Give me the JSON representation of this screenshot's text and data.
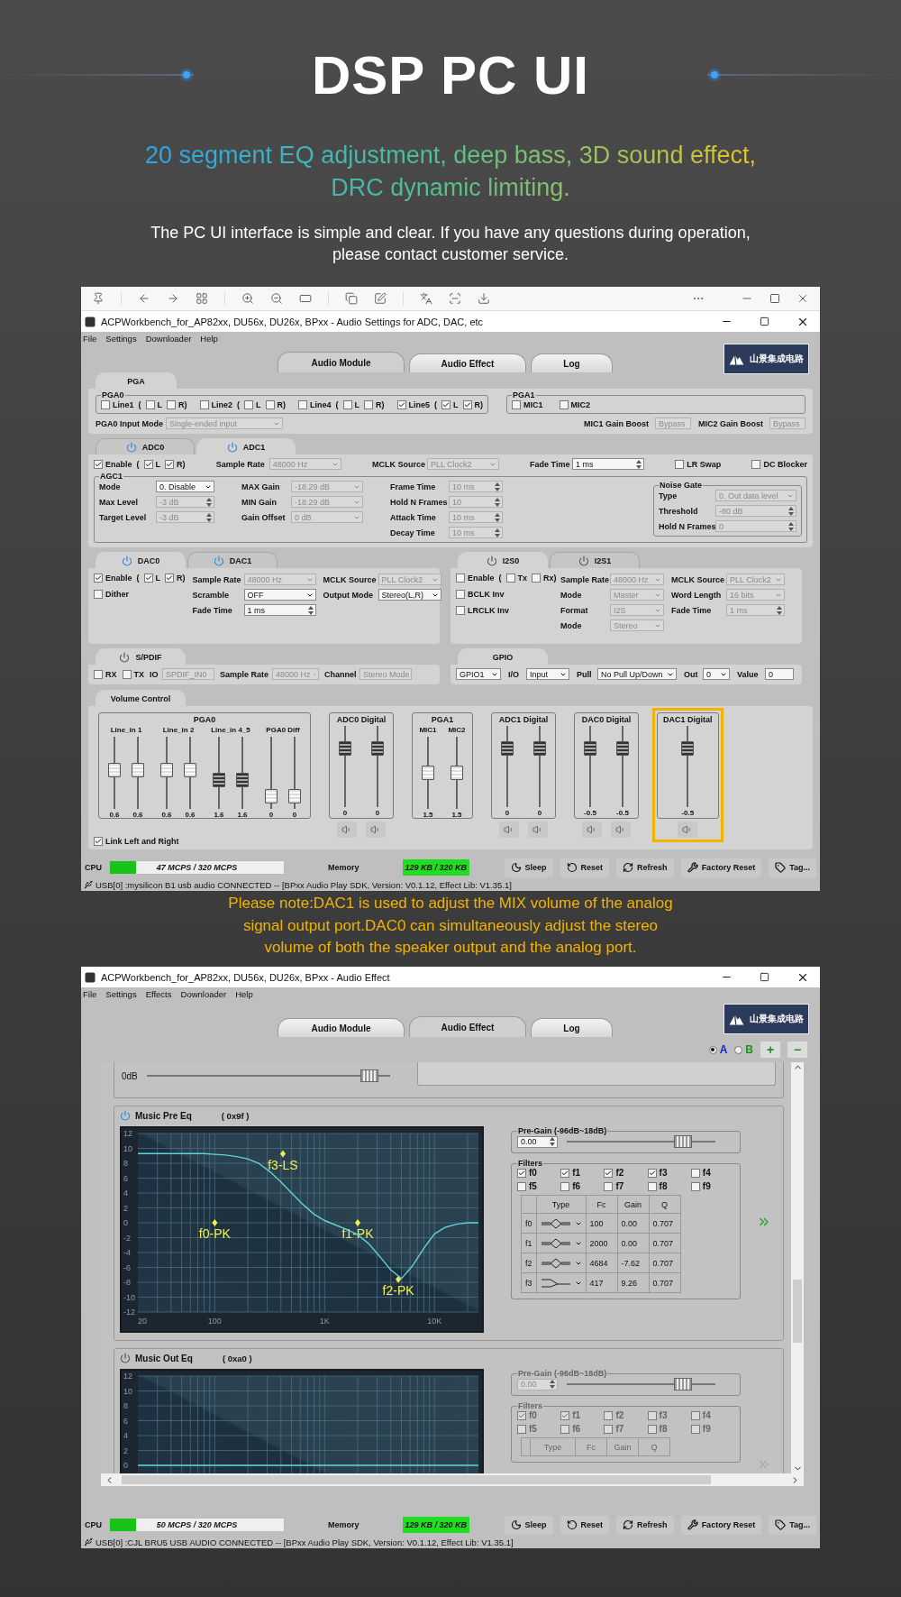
{
  "header": {
    "title": "DSP PC UI",
    "subtitle": [
      "20 segment EQ adjustment, deep bass, 3D sound effect,",
      "DRC dynamic limiting."
    ],
    "description": [
      "The PC UI interface is simple and clear. If you have any questions during operation,",
      "please contact customer service."
    ]
  },
  "settings_window": {
    "title": "ACPWorkbench_for_AP82xx, DU56x, DU26x, BPxx - Audio Settings for ADC, DAC, etc",
    "menu": [
      "File",
      "Settings",
      "Downloader",
      "Help"
    ],
    "tabs": [
      {
        "label": "Audio Module",
        "selected": true
      },
      {
        "label": "Audio Effect",
        "selected": false
      },
      {
        "label": "Log",
        "selected": false
      }
    ],
    "logo": "山景集成电路",
    "pga": {
      "tab": "PGA",
      "pga0": {
        "title": "PGA0",
        "inputs": [
          {
            "label": "Line1",
            "checked": false,
            "open": "(",
            "left": {
              "label": "L",
              "checked": false
            },
            "right": {
              "label": "R)",
              "checked": false
            }
          },
          {
            "label": "Line2",
            "checked": false,
            "open": "(",
            "left": {
              "label": "L",
              "checked": false
            },
            "right": {
              "label": "R)",
              "checked": false
            }
          },
          {
            "label": "Line4",
            "checked": false,
            "open": "(",
            "left": {
              "label": "L",
              "checked": false
            },
            "right": {
              "label": "R)",
              "checked": false
            }
          },
          {
            "label": "Line5",
            "checked": true,
            "open": "(",
            "left": {
              "label": "L",
              "checked": true
            },
            "right": {
              "label": "R)",
              "checked": true
            }
          }
        ],
        "input_mode": {
          "label": "PGA0 Input Mode",
          "value": "Single-ended input",
          "kind": "combo",
          "disabled": true
        }
      },
      "pga1": {
        "title": "PGA1",
        "mics": [
          {
            "label": "MIC1",
            "checked": false
          },
          {
            "label": "MIC2",
            "checked": false
          }
        ],
        "boosts": [
          {
            "label": "MIC1 Gain Boost",
            "value": "Bypass",
            "kind": "combo",
            "disabled": true
          },
          {
            "label": "MIC2 Gain Boost",
            "value": "Bypass",
            "kind": "combo",
            "disabled": true
          }
        ]
      }
    },
    "adc": {
      "tabs": [
        {
          "label": "ADC0",
          "selected": false,
          "powered": true
        },
        {
          "label": "ADC1",
          "selected": true,
          "powered": true
        }
      ],
      "enable": {
        "label": "Enable",
        "checked": true,
        "open": "(",
        "left": {
          "label": "L",
          "checked": true
        },
        "right": {
          "label": "R)",
          "checked": true
        }
      },
      "fields": [
        {
          "label": "Sample Rate",
          "value": "48000 Hz",
          "kind": "combo",
          "disabled": true
        },
        {
          "label": "MCLK Source",
          "value": "PLL Clock2",
          "kind": "combo",
          "disabled": true
        },
        {
          "label": "Fade Time",
          "value": "1 ms",
          "kind": "spin",
          "disabled": false
        }
      ],
      "options": [
        {
          "label": "LR Swap",
          "checked": false
        },
        {
          "label": "DC Blocker",
          "checked": false
        }
      ],
      "agc": {
        "title": "AGC1",
        "columns": [
          [
            {
              "label": "Mode",
              "value": "0. Disable",
              "kind": "combo",
              "disabled": false
            },
            {
              "label": "Max Level",
              "value": "-3 dB",
              "kind": "spin",
              "disabled": true
            },
            {
              "label": "Target Level",
              "value": "-3 dB",
              "kind": "spin",
              "disabled": true
            }
          ],
          [
            {
              "label": "MAX Gain",
              "value": "-18.29 dB",
              "kind": "combo",
              "disabled": true
            },
            {
              "label": "MIN Gain",
              "value": "-18.29 dB",
              "kind": "combo",
              "disabled": true
            },
            {
              "label": "Gain Offset",
              "value": "0 dB",
              "kind": "combo",
              "disabled": true
            }
          ],
          [
            {
              "label": "Frame Time",
              "value": "10 ms",
              "kind": "spin",
              "disabled": true
            },
            {
              "label": "Hold N Frames",
              "value": "10",
              "kind": "spin",
              "disabled": true
            },
            {
              "label": "Attack Time",
              "value": "10 ms",
              "kind": "spin",
              "disabled": true
            },
            {
              "label": "Decay Time",
              "value": "10 ms",
              "kind": "spin",
              "disabled": true
            }
          ]
        ]
      },
      "noise_gate": {
        "title": "Noise Gate",
        "fields": [
          {
            "label": "Type",
            "value": "0. Out data level",
            "kind": "combo",
            "disabled": true
          },
          {
            "label": "Threshold",
            "value": "-80 dB",
            "kind": "spin",
            "disabled": true
          },
          {
            "label": "Hold N Frames",
            "value": "0",
            "kind": "spin",
            "disabled": true
          }
        ]
      }
    },
    "dac": {
      "tabs": [
        {
          "label": "DAC0",
          "selected": true,
          "powered": true
        },
        {
          "label": "DAC1",
          "selected": false,
          "powered": true
        }
      ],
      "enable": {
        "label": "Enable",
        "checked": true,
        "open": "(",
        "left": {
          "label": "L",
          "checked": true
        },
        "right": {
          "label": "R)",
          "checked": true
        }
      },
      "options": [
        {
          "label": "Dither",
          "checked": false
        }
      ],
      "columns": [
        [
          {
            "label": "Sample Rate",
            "value": "48000 Hz",
            "kind": "combo",
            "disabled": true
          },
          {
            "label": "Scramble",
            "value": "OFF",
            "kind": "combo",
            "disabled": false
          },
          {
            "label": "Fade Time",
            "value": "1 ms",
            "kind": "spin",
            "disabled": false
          }
        ],
        [
          {
            "label": "MCLK Source",
            "value": "PLL Clock2",
            "kind": "combo",
            "disabled": true
          },
          {
            "label": "Output Mode",
            "value": "Stereo(L,R)",
            "kind": "combo",
            "disabled": false
          }
        ]
      ]
    },
    "i2s": {
      "tabs": [
        {
          "label": "I2S0",
          "selected": true,
          "powered": false
        },
        {
          "label": "I2S1",
          "selected": false,
          "powered": false
        }
      ],
      "enable": {
        "label": "Enable",
        "checked": false,
        "open": "(",
        "left": {
          "label": "Tx",
          "checked": false
        },
        "right": {
          "label": "Rx)",
          "checked": false
        }
      },
      "options": [
        {
          "label": "BCLK Inv",
          "checked": false
        },
        {
          "label": "LRCLK Inv",
          "checked": false
        }
      ],
      "columns": [
        [
          {
            "label": "Sample Rate",
            "value": "48000 Hz",
            "kind": "combo",
            "disabled": true
          },
          {
            "label": "Mode",
            "value": "Master",
            "kind": "combo",
            "disabled": true
          },
          {
            "label": "Format",
            "value": "I2S",
            "kind": "combo",
            "disabled": true
          },
          {
            "label": "Mode",
            "value": "Stereo",
            "kind": "combo",
            "disabled": true
          }
        ],
        [
          {
            "label": "MCLK Source",
            "value": "PLL Clock2",
            "kind": "combo",
            "disabled": true
          },
          {
            "label": "Word Length",
            "value": "16 bits",
            "kind": "combo",
            "disabled": true
          },
          {
            "label": "Fade Time",
            "value": "1 ms",
            "kind": "spin",
            "disabled": true
          }
        ]
      ]
    },
    "spdif": {
      "tab": {
        "label": "S/PDIF",
        "powered": false
      },
      "options": [
        {
          "label": "RX",
          "checked": false
        },
        {
          "label": "TX",
          "checked": false
        }
      ],
      "fields": [
        {
          "label": "IO",
          "value": "SPDIF_IN0",
          "kind": "combo",
          "disabled": true
        },
        {
          "label": "Sample Rate",
          "value": "48000 Hz",
          "kind": "combo",
          "disabled": true
        },
        {
          "label": "Channel",
          "value": "Stereo Mode",
          "kind": "combo",
          "disabled": true
        }
      ]
    },
    "gpio": {
      "tab": "GPIO",
      "fields": [
        {
          "value": "GPIO1",
          "kind": "combo",
          "disabled": false
        },
        {
          "label": "I/O",
          "value": "Input",
          "kind": "combo",
          "disabled": false
        },
        {
          "label": "Pull",
          "value": "No Pull Up/Down",
          "kind": "combo",
          "disabled": false
        },
        {
          "label": "Out",
          "value": "0",
          "kind": "combo",
          "disabled": false
        },
        {
          "label": "Value",
          "value": "0",
          "kind": "text",
          "disabled": false
        }
      ]
    },
    "volume": {
      "tab": "Volume Control",
      "groups": [
        {
          "title": "PGA0",
          "mute_buttons": false,
          "highlighted": false,
          "columns": [
            {
              "label": "Line_in 1",
              "sliders": [
                {
                  "level": 0.55,
                  "reading": "0.6",
                  "enabled": false
                },
                {
                  "level": 0.55,
                  "reading": "0.6",
                  "enabled": false
                }
              ]
            },
            {
              "label": "Line_in 2",
              "sliders": [
                {
                  "level": 0.55,
                  "reading": "0.6",
                  "enabled": false
                },
                {
                  "level": 0.55,
                  "reading": "0.6",
                  "enabled": false
                }
              ]
            },
            {
              "label": "Line_in 4_5",
              "sliders": [
                {
                  "level": 0.38,
                  "reading": "1.6",
                  "enabled": true
                },
                {
                  "level": 0.38,
                  "reading": "1.6",
                  "enabled": true
                }
              ]
            },
            {
              "label": "PGA0 Diff",
              "sliders": [
                {
                  "level": 0.1,
                  "reading": "0",
                  "enabled": false
                },
                {
                  "level": 0.1,
                  "reading": "0",
                  "enabled": false
                }
              ]
            }
          ]
        },
        {
          "title": "ADC0 Digital",
          "mute_buttons": true,
          "highlighted": false,
          "columns": [
            {
              "sliders": [
                {
                  "level": 0.77,
                  "reading": "0",
                  "enabled": true
                },
                {
                  "level": 0.77,
                  "reading": "0",
                  "enabled": true
                }
              ]
            }
          ]
        },
        {
          "title": "PGA1",
          "mute_buttons": false,
          "highlighted": false,
          "columns": [
            {
              "label": "MIC1",
              "sliders": [
                {
                  "level": 0.5,
                  "reading": "1.5",
                  "enabled": false
                }
              ]
            },
            {
              "label": "MIC2",
              "sliders": [
                {
                  "level": 0.5,
                  "reading": "1.5",
                  "enabled": false
                }
              ]
            }
          ]
        },
        {
          "title": "ADC1 Digital",
          "mute_buttons": true,
          "highlighted": false,
          "columns": [
            {
              "sliders": [
                {
                  "level": 0.77,
                  "reading": "0",
                  "enabled": true
                },
                {
                  "level": 0.77,
                  "reading": "0",
                  "enabled": true
                }
              ]
            }
          ]
        },
        {
          "title": "DAC0 Digital",
          "mute_buttons": true,
          "highlighted": false,
          "columns": [
            {
              "sliders": [
                {
                  "level": 0.77,
                  "reading": "-0.5",
                  "enabled": true
                },
                {
                  "level": 0.77,
                  "reading": "-0.5",
                  "enabled": true
                }
              ]
            }
          ]
        },
        {
          "title": "DAC1 Digital",
          "mute_buttons": true,
          "highlighted": true,
          "columns": [
            {
              "sliders": [
                {
                  "level": 0.77,
                  "reading": "-0.5",
                  "enabled": true
                }
              ]
            }
          ]
        }
      ],
      "link": {
        "label": "Link Left and Right",
        "checked": true
      }
    },
    "status": {
      "cpu": {
        "label": "CPU",
        "reading": "47 MCPS / 320 MCPS",
        "level": 0.15
      },
      "memory": {
        "label": "Memory",
        "reading": "129 KB / 320 KB"
      },
      "buttons": [
        {
          "label": "Sleep",
          "kind": "sleep"
        },
        {
          "label": "Reset",
          "kind": "reset"
        },
        {
          "label": "Refresh",
          "kind": "refresh"
        },
        {
          "label": "Factory Reset",
          "kind": "factory"
        },
        {
          "label": "Tag...",
          "kind": "tag"
        }
      ]
    },
    "footer": "USB[0] :mysilicon B1 usb audio CONNECTED -- [BPxx Audio Play SDK,  Version: V0.1.12,  Effect Lib: V1.35.1]"
  },
  "note": [
    "Please note:DAC1 is used to adjust the MIX volume of the analog",
    "signal output port.DAC0 can simultaneously adjust the stereo",
    "volume of both the speaker output and the analog port."
  ],
  "effect_window": {
    "title": "ACPWorkbench_for_AP82xx, DU56x, DU26x, BPxx - Audio Effect",
    "menu": [
      "File",
      "Settings",
      "Effects",
      "Downloader",
      "Help"
    ],
    "tabs": [
      {
        "label": "Audio Module",
        "selected": false
      },
      {
        "label": "Audio Effect",
        "selected": true
      },
      {
        "label": "Log",
        "selected": false
      }
    ],
    "logo": "山景集成电路",
    "presets": [
      {
        "label": "A",
        "selected": true,
        "color": "#1c1cd8"
      },
      {
        "label": "B",
        "selected": false,
        "color": "#1d8f1d"
      }
    ],
    "actions": [
      "+",
      "−"
    ],
    "top_section": {
      "slider": {
        "label": "0dB",
        "level": 0.95
      }
    },
    "eq_sections": [
      {
        "title": "Music Pre Eq",
        "code": "( 0x9f )",
        "powered": true,
        "enabled": true,
        "chart_data": {
          "type": "line",
          "grid": true,
          "categories": [
            "20",
            null,
            null,
            null,
            null,
            null,
            null,
            "100",
            null,
            null,
            null,
            null,
            null,
            null,
            null,
            null,
            null,
            "1K",
            null,
            null,
            null,
            null,
            null,
            null,
            null,
            null,
            null,
            "10K",
            null,
            null,
            null,
            null
          ],
          "series": [
            {
              "color": "#5fd3d3",
              "values": [
                9.3,
                9.3,
                9.3,
                9.3,
                9.3,
                9.3,
                9.3,
                9.2,
                9.1,
                8.9,
                8.6,
                8.0,
                6.9,
                5.5,
                4.0,
                2.5,
                1.2,
                0.3,
                -0.3,
                -0.9,
                -1.6,
                -2.8,
                -4.5,
                -6.3,
                -7.5,
                -5.8,
                -3.5,
                -1.5,
                -0.6,
                -0.2,
                0,
                0
              ]
            }
          ],
          "ylim": [
            -12,
            12
          ],
          "yticks": [
            12,
            10,
            8,
            6,
            4,
            2,
            0,
            -2,
            -4,
            -6,
            -8,
            -10,
            -12
          ],
          "annotations": [
            "f0-PK",
            "f1-PK",
            "f2-PK",
            "f3-LS"
          ]
        },
        "pre_gain": {
          "title": "Pre-Gain (-96dB~18dB)",
          "value": "0.00",
          "level": 0.82
        },
        "filters": {
          "title": "Filters",
          "items": [
            {
              "label": "f0",
              "checked": true
            },
            {
              "label": "f1",
              "checked": true
            },
            {
              "label": "f2",
              "checked": true
            },
            {
              "label": "f3",
              "checked": true
            },
            {
              "label": "f4",
              "checked": false
            },
            {
              "label": "f5",
              "checked": false
            },
            {
              "label": "f6",
              "checked": false
            },
            {
              "label": "f7",
              "checked": false
            },
            {
              "label": "f8",
              "checked": false
            },
            {
              "label": "f9",
              "checked": false
            }
          ],
          "columns": [
            "Type",
            "Fc",
            "Gain",
            "Q"
          ],
          "rows": [
            {
              "label": "f0",
              "kind": "peak",
              "fc": "100",
              "gain": "0.00",
              "q": "0.707"
            },
            {
              "label": "f1",
              "kind": "peak",
              "fc": "2000",
              "gain": "0.00",
              "q": "0.707"
            },
            {
              "label": "f2",
              "kind": "peak",
              "fc": "4684",
              "gain": "-7.62",
              "q": "0.707"
            },
            {
              "label": "f3",
              "kind": "shelf",
              "fc": "417",
              "gain": "9.26",
              "q": "0.707"
            }
          ]
        }
      },
      {
        "title": "Music Out Eq",
        "code": "( 0xa0 )",
        "powered": false,
        "enabled": false,
        "chart_data": {
          "type": "line",
          "grid": true,
          "series": [
            {
              "color": "#5fd3d3",
              "values": [
                0,
                0,
                0,
                0,
                0,
                0,
                0,
                0,
                0,
                0,
                0,
                0,
                0,
                0,
                0,
                0,
                0,
                0,
                0,
                0,
                0,
                0,
                0,
                0,
                0,
                0,
                0,
                0,
                0,
                0,
                0,
                0
              ]
            }
          ],
          "ylim": [
            -12,
            12
          ],
          "yticks": [
            12,
            10,
            8,
            6,
            4,
            2,
            0
          ]
        },
        "pre_gain": {
          "title": "Pre-Gain (-96dB~18dB)",
          "value": "0.00",
          "level": 0.82
        },
        "filters": {
          "title": "Filters",
          "items": [
            {
              "label": "f0",
              "checked": true
            },
            {
              "label": "f1",
              "checked": true
            },
            {
              "label": "f2",
              "checked": false
            },
            {
              "label": "f3",
              "checked": false
            },
            {
              "label": "f4",
              "checked": false
            },
            {
              "label": "f5",
              "checked": false
            },
            {
              "label": "f6",
              "checked": false
            },
            {
              "label": "f7",
              "checked": false
            },
            {
              "label": "f8",
              "checked": false
            },
            {
              "label": "f9",
              "checked": false
            }
          ],
          "columns": [
            "Type",
            "Fc",
            "Gain",
            "Q"
          ]
        }
      }
    ],
    "status": {
      "cpu": {
        "label": "CPU",
        "reading": "50 MCPS / 320 MCPS",
        "level": 0.15
      },
      "memory": {
        "label": "Memory",
        "reading": "129 KB / 320 KB"
      },
      "buttons": [
        {
          "label": "Sleep",
          "kind": "sleep"
        },
        {
          "label": "Reset",
          "kind": "reset"
        },
        {
          "label": "Refresh",
          "kind": "refresh"
        },
        {
          "label": "Factory Reset",
          "kind": "factory"
        },
        {
          "label": "Tag...",
          "kind": "tag"
        }
      ]
    },
    "footer": "USB[0] :CJL BRU5 USB AUDIO CONNECTED -- [BPxx Audio Play SDK,  Version: V0.1.12,  Effect Lib: V1.35.1]"
  }
}
